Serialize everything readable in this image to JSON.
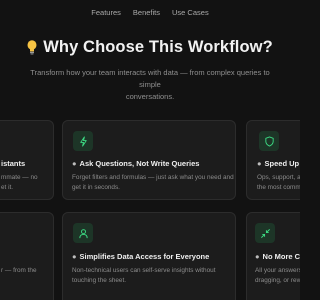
{
  "nav": {
    "items": [
      "Features",
      "Benefits",
      "Use Cases"
    ]
  },
  "hero": {
    "title": "Why Choose This Workflow?",
    "subtitle_line1": "Transform how your team interacts with data — from complex queries to simple",
    "subtitle_line2": "conversations."
  },
  "cards": {
    "left_top": {
      "title": "istants",
      "desc_line1": "mmate — no",
      "desc_line2": "et it."
    },
    "ask": {
      "title": "Ask Questions, Not Write Queries",
      "desc_line1": "Forget filters and formulas — just ask what you need and",
      "desc_line2": "get it in seconds."
    },
    "speed": {
      "title": "Speed Up F",
      "desc_line1": "Ops, support, a",
      "desc_line2": "the most comm"
    },
    "left_bottom": {
      "desc_line1": "r — from the"
    },
    "simplify": {
      "title": "Simplifies Data Access for Everyone",
      "desc_line1": "Non-technical users can self-serve insights without",
      "desc_line2": "touching the sheet."
    },
    "nomore": {
      "title": "No More Co",
      "desc_line1": "All your answers",
      "desc_line2": "dragging, or rew"
    }
  },
  "colors": {
    "accent": "#3ddc84",
    "icon_bg": "#1d3527",
    "card_bg": "#1c1c1c"
  },
  "icons": [
    "lightbulb-icon",
    "lightning-icon",
    "shield-icon",
    "user-icon",
    "collapse-arrows-icon"
  ]
}
